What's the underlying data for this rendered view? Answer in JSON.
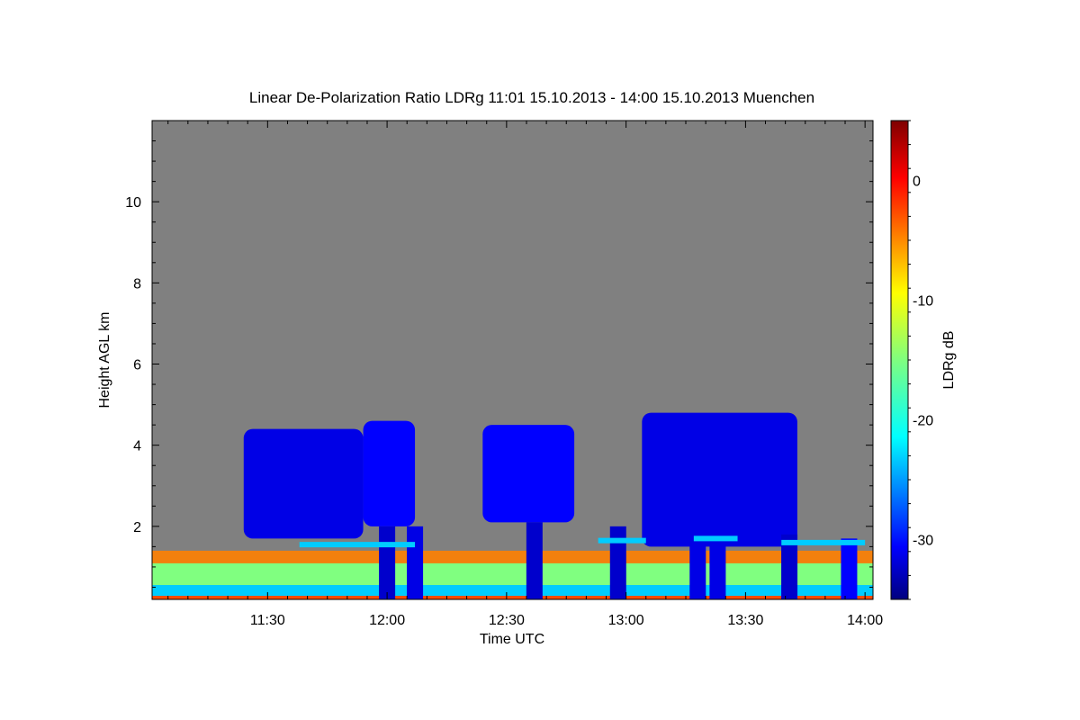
{
  "chart_data": {
    "type": "heatmap",
    "title": "Linear De-Polarization Ratio LDRg   11:01 15.10.2013 - 14:00 15.10.2013 Muenchen",
    "xlabel": "Time UTC",
    "ylabel": "Height AGL km",
    "colorbar_label": "LDRg dB",
    "x_range_minutes": [
      661,
      842
    ],
    "x_ticks": [
      {
        "label": "11:30",
        "value": 690
      },
      {
        "label": "12:00",
        "value": 720
      },
      {
        "label": "12:30",
        "value": 750
      },
      {
        "label": "13:00",
        "value": 780
      },
      {
        "label": "13:30",
        "value": 810
      },
      {
        "label": "14:00",
        "value": 840
      }
    ],
    "ylim": [
      0.2,
      12.0
    ],
    "y_ticks": [
      {
        "label": "2",
        "value": 2
      },
      {
        "label": "4",
        "value": 4
      },
      {
        "label": "6",
        "value": 6
      },
      {
        "label": "8",
        "value": 8
      },
      {
        "label": "10",
        "value": 10
      }
    ],
    "colorbar_range": [
      -35,
      5
    ],
    "colorbar_ticks": [
      {
        "label": "0",
        "value": 0
      },
      {
        "label": "-10",
        "value": -10
      },
      {
        "label": "-20",
        "value": -20
      },
      {
        "label": "-30",
        "value": -30
      }
    ],
    "colormap": "jet",
    "background_color": "#808080",
    "cloud_segments": [
      {
        "start": 684,
        "end": 714,
        "base_km": 1.7,
        "top_km": 4.4,
        "ldr_db": -31
      },
      {
        "start": 714,
        "end": 727,
        "base_km": 2.0,
        "top_km": 4.6,
        "ldr_db": -30
      },
      {
        "start": 744,
        "end": 767,
        "base_km": 2.1,
        "top_km": 4.5,
        "ldr_db": -30
      },
      {
        "start": 784,
        "end": 823,
        "base_km": 1.5,
        "top_km": 4.8,
        "ldr_db": -31
      }
    ],
    "fall_streaks": [
      {
        "time": 720,
        "top_km": 2.0,
        "ldr_db": -32
      },
      {
        "time": 727,
        "top_km": 2.0,
        "ldr_db": -31
      },
      {
        "time": 757,
        "top_km": 2.1,
        "ldr_db": -32
      },
      {
        "time": 778,
        "top_km": 2.0,
        "ldr_db": -32
      },
      {
        "time": 798,
        "top_km": 1.7,
        "ldr_db": -31
      },
      {
        "time": 803,
        "top_km": 1.8,
        "ldr_db": -31
      },
      {
        "time": 821,
        "top_km": 1.8,
        "ldr_db": -32
      },
      {
        "time": 836,
        "top_km": 1.7,
        "ldr_db": -30
      }
    ],
    "melting_layer": [
      {
        "start": 698,
        "end": 727,
        "height_km": 1.55,
        "ldr_db": -22
      },
      {
        "start": 773,
        "end": 785,
        "height_km": 1.65,
        "ldr_db": -22
      },
      {
        "start": 797,
        "end": 808,
        "height_km": 1.7,
        "ldr_db": -22
      },
      {
        "start": 819,
        "end": 840,
        "height_km": 1.6,
        "ldr_db": -22
      }
    ],
    "boundary_layer": {
      "top_km": 1.4,
      "ldr_db_range": [
        -22,
        -5
      ]
    }
  }
}
